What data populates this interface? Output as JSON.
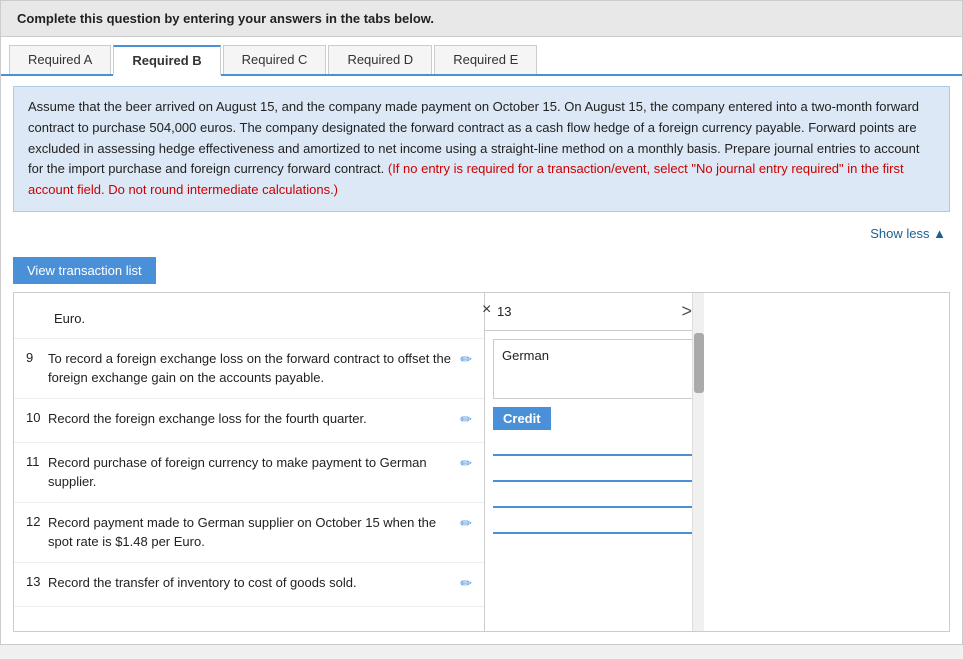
{
  "instruction_bar": {
    "text": "Complete this question by entering your answers in the tabs below."
  },
  "tabs": [
    {
      "label": "Required A",
      "active": false
    },
    {
      "label": "Required B",
      "active": true
    },
    {
      "label": "Required C",
      "active": false
    },
    {
      "label": "Required D",
      "active": false
    },
    {
      "label": "Required E",
      "active": false
    }
  ],
  "description": {
    "main_text": "Assume that the beer arrived on August 15, and the company made payment on October 15. On August 15, the company entered into a two-month forward contract to purchase 504,000 euros. The company designated the forward contract as a cash flow hedge of a foreign currency payable. Forward points are excluded in assessing hedge effectiveness and amortized to net income using a straight-line method on a monthly basis. Prepare journal entries to account for the import purchase and foreign currency forward contract.",
    "red_text": "(If no entry is required for a transaction/event, select \"No journal entry required\" in the first account field. Do not round intermediate calculations.)"
  },
  "show_less": "Show less ▲",
  "view_transaction_btn": "View transaction list",
  "close_btn": "×",
  "euro_row": "Euro.",
  "right_panel": {
    "page_number": "13",
    "arrow": ">",
    "german_text": "German"
  },
  "credit_label": "Credit",
  "transactions": [
    {
      "num": "9",
      "desc": "To record a foreign exchange loss on the forward contract to offset the foreign exchange gain on the accounts payable."
    },
    {
      "num": "10",
      "desc": "Record the foreign exchange loss for the fourth quarter."
    },
    {
      "num": "11",
      "desc": "Record purchase of foreign currency to make payment to German supplier."
    },
    {
      "num": "12",
      "desc": "Record payment made to German supplier on October 15 when the spot rate is $1.48 per Euro."
    },
    {
      "num": "13",
      "desc": "Record the transfer of inventory to cost of goods sold."
    }
  ]
}
